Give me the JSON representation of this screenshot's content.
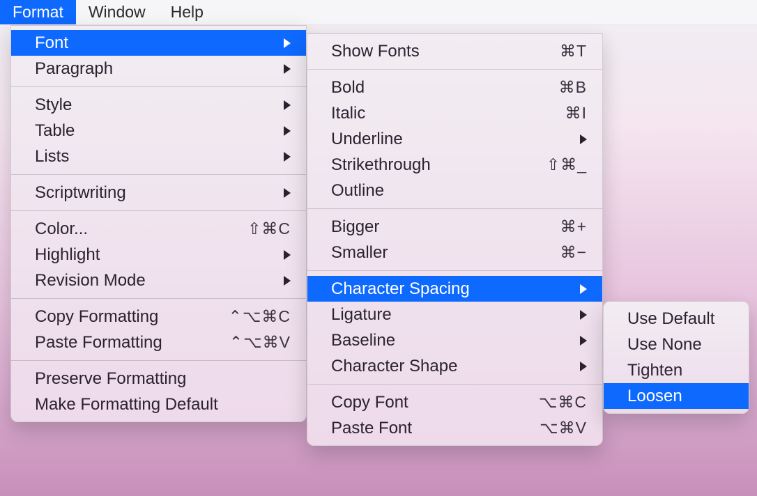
{
  "menubar": {
    "format": "Format",
    "window": "Window",
    "help": "Help"
  },
  "formatMenu": {
    "font": "Font",
    "paragraph": "Paragraph",
    "style": "Style",
    "table": "Table",
    "lists": "Lists",
    "scriptwriting": "Scriptwriting",
    "color": "Color...",
    "color_sc": "⇧⌘C",
    "highlight": "Highlight",
    "revision": "Revision Mode",
    "copyFmt": "Copy Formatting",
    "copyFmt_sc": "⌃⌥⌘C",
    "pasteFmt": "Paste Formatting",
    "pasteFmt_sc": "⌃⌥⌘V",
    "preserve": "Preserve Formatting",
    "makeDefault": "Make Formatting Default"
  },
  "fontMenu": {
    "showFonts": "Show Fonts",
    "showFonts_sc": "⌘T",
    "bold": "Bold",
    "bold_sc": "⌘B",
    "italic": "Italic",
    "italic_sc": "⌘I",
    "underline": "Underline",
    "strike": "Strikethrough",
    "strike_sc": "⇧⌘_",
    "outline": "Outline",
    "bigger": "Bigger",
    "bigger_sc": "⌘+",
    "smaller": "Smaller",
    "smaller_sc": "⌘−",
    "charSpacing": "Character Spacing",
    "ligature": "Ligature",
    "baseline": "Baseline",
    "charShape": "Character Shape",
    "copyFont": "Copy Font",
    "copyFont_sc": "⌥⌘C",
    "pasteFont": "Paste Font",
    "pasteFont_sc": "⌥⌘V"
  },
  "spacingMenu": {
    "useDefault": "Use Default",
    "useNone": "Use None",
    "tighten": "Tighten",
    "loosen": "Loosen"
  }
}
